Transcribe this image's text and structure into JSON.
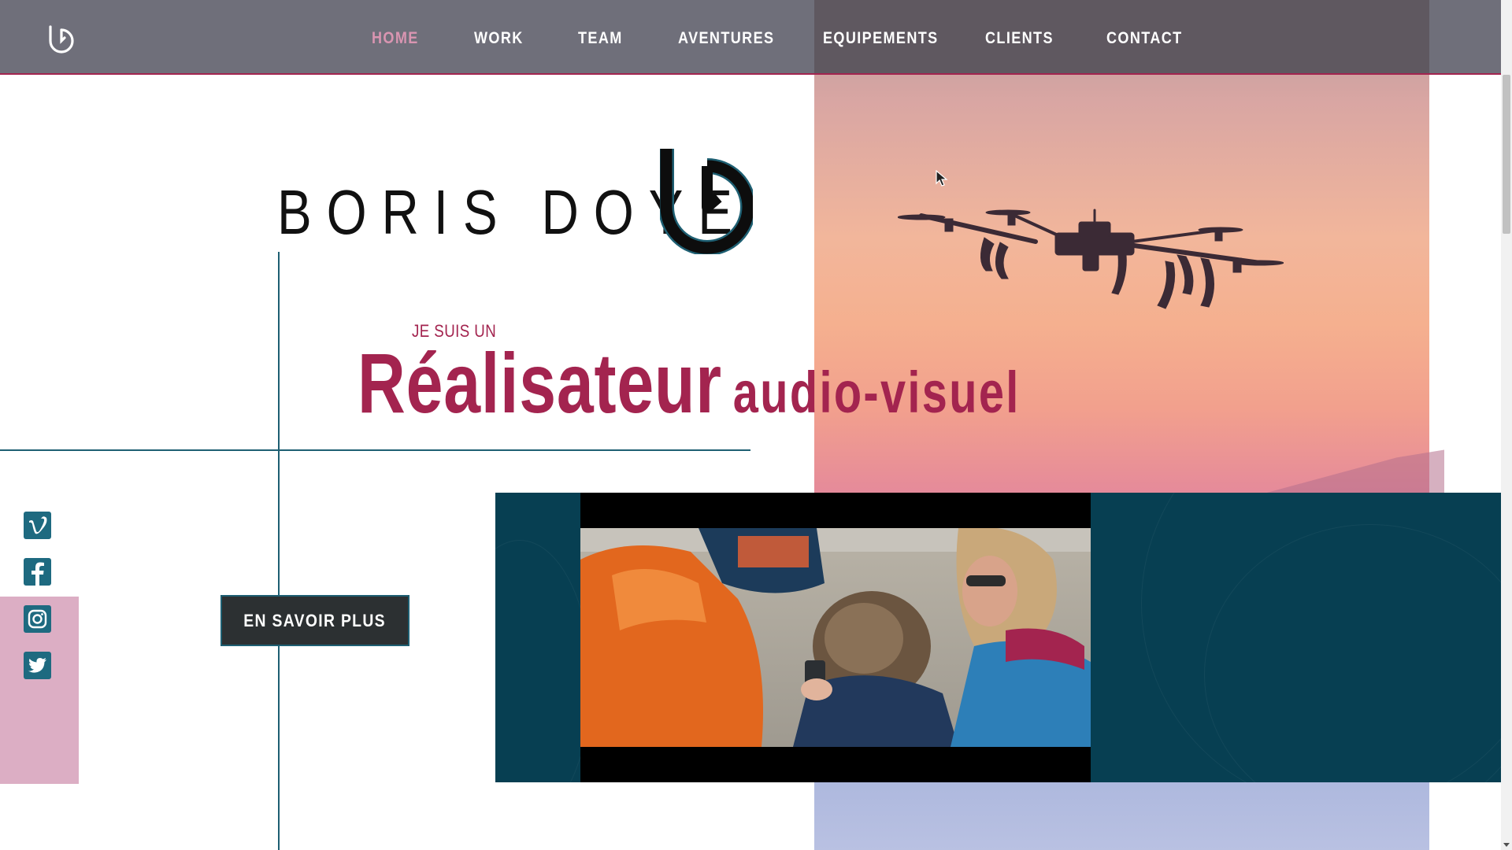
{
  "nav": {
    "items": [
      {
        "label": "HOME",
        "active": true
      },
      {
        "label": "WORK",
        "active": false
      },
      {
        "label": "TEAM",
        "active": false
      },
      {
        "label": "AVENTURES",
        "active": false
      },
      {
        "label": "EQUIPEMENTS",
        "active": false
      },
      {
        "label": "CLIENTS",
        "active": false
      },
      {
        "label": "CONTACT",
        "active": false
      }
    ],
    "logo_icon": "bd-logo-icon"
  },
  "hero": {
    "title": "BORIS DOYE",
    "subtitle": "JE SUIS UN",
    "headline_main": "Réalisateur",
    "headline_secondary": "audio-visuel",
    "button_label": "EN SAVOIR PLUS",
    "background_image": "drone-sunset-photo"
  },
  "social": [
    {
      "name": "vimeo-icon"
    },
    {
      "name": "facebook-icon"
    },
    {
      "name": "instagram-icon"
    },
    {
      "name": "twitter-icon"
    }
  ],
  "video": {
    "thumbnail": "family-phone-photo"
  },
  "colors": {
    "accent": "#a3244f",
    "teal": "#1e5f72",
    "navbar": "#646470",
    "band": "#073f52",
    "social_bg": "#dcaec4",
    "active_nav": "#d995b1"
  }
}
